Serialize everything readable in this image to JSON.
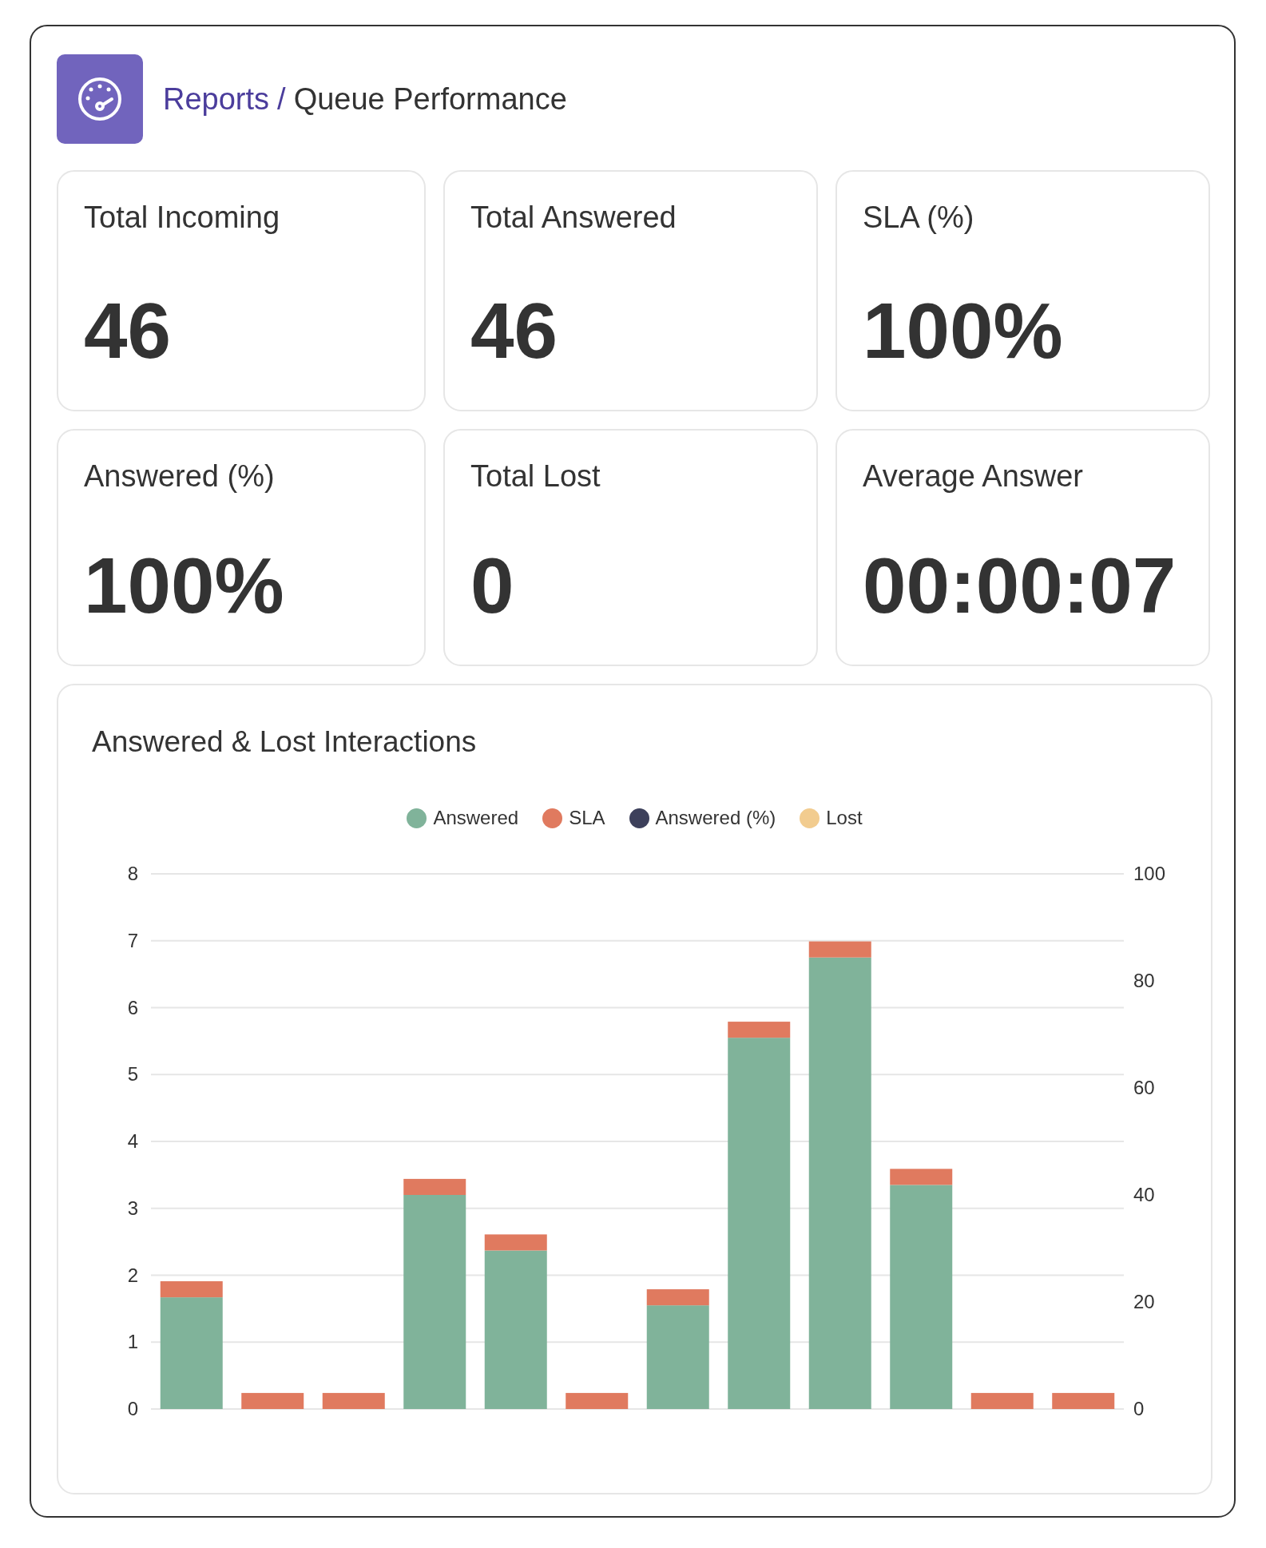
{
  "breadcrumb": {
    "parent": "Reports",
    "separator": "/",
    "current": "Queue Performance"
  },
  "stats": [
    {
      "label": "Total Incoming",
      "value": "46"
    },
    {
      "label": "Total Answered",
      "value": "46"
    },
    {
      "label": "SLA (%)",
      "value": "100%"
    },
    {
      "label": "Answered (%)",
      "value": "100%"
    },
    {
      "label": "Total Lost",
      "value": "0"
    },
    {
      "label": "Average Answer",
      "value": "00:00:07"
    }
  ],
  "chart": {
    "title": "Answered & Lost Interactions",
    "chart_data": {
      "type": "bar",
      "stacked": true,
      "grid": true,
      "legend": true,
      "ylim": [
        0,
        8
      ],
      "yticks": [
        0,
        1,
        2,
        3,
        4,
        5,
        6,
        7,
        8
      ],
      "y2ticks": [
        "0",
        "20",
        "40",
        "60",
        "80",
        "100"
      ],
      "series": [
        {
          "name": "Answered",
          "color": "#80b39a",
          "values": [
            1.67,
            0,
            0,
            3.2,
            2.37,
            0,
            1.55,
            5.55,
            6.75,
            3.35,
            0,
            0
          ]
        },
        {
          "name": "SLA",
          "color": "#e07a5f",
          "values": [
            0.24,
            0.24,
            0.24,
            0.24,
            0.24,
            0.24,
            0.24,
            0.24,
            0.24,
            0.24,
            0.24,
            0.24
          ]
        },
        {
          "name": "Answered (%)",
          "color": "#3d405b",
          "values": [
            null,
            null,
            null,
            null,
            null,
            null,
            null,
            null,
            null,
            null,
            null,
            null
          ]
        },
        {
          "name": "Lost",
          "color": "#f2cc8f",
          "values": [
            null,
            null,
            null,
            null,
            null,
            null,
            null,
            null,
            null,
            null,
            null,
            null
          ]
        }
      ]
    }
  }
}
